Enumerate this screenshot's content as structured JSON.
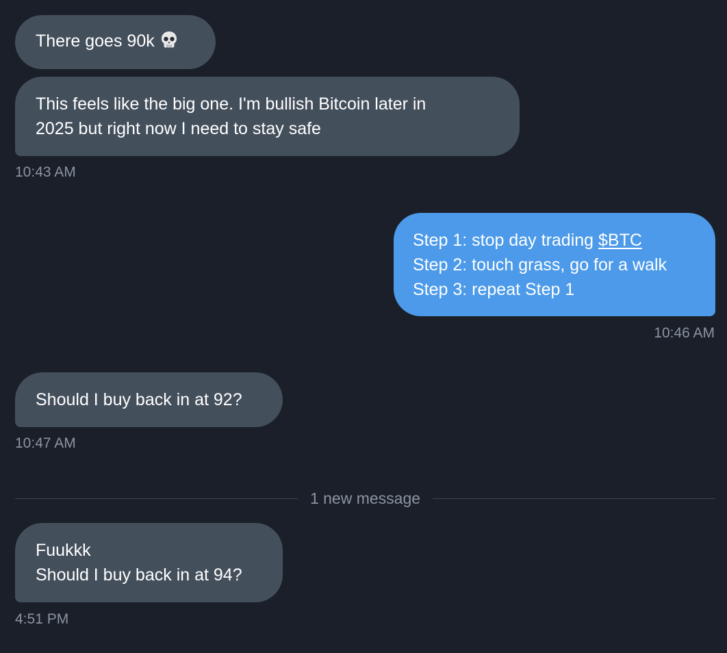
{
  "colors": {
    "background": "#1a1f29",
    "incoming_bubble": "#444f5c",
    "outgoing_bubble": "#4c9ae9",
    "timestamp": "#8b95a1",
    "text": "#ffffff"
  },
  "messages": [
    {
      "direction": "incoming",
      "lines": [
        "There goes 90k"
      ],
      "emoji": "skull-icon"
    },
    {
      "direction": "incoming",
      "lines": [
        "This feels like the big one. I'm bullish Bitcoin later in",
        "2025 but right now I need to stay safe"
      ],
      "timestamp": "10:43 AM"
    },
    {
      "direction": "outgoing",
      "line1_prefix": "Step 1:  stop day trading ",
      "line1_cashtag": "$BTC",
      "line2": "Step 2:  touch grass, go for a walk",
      "line3": "Step 3:  repeat Step 1",
      "timestamp": "10:46 AM"
    },
    {
      "direction": "incoming",
      "lines": [
        "Should I buy back in at 92?"
      ],
      "timestamp": "10:47 AM"
    },
    {
      "direction": "incoming",
      "lines": [
        "Fuukkk",
        "Should I buy back in at 94?"
      ],
      "timestamp": "4:51 PM"
    }
  ],
  "divider": {
    "label": "1 new message"
  }
}
